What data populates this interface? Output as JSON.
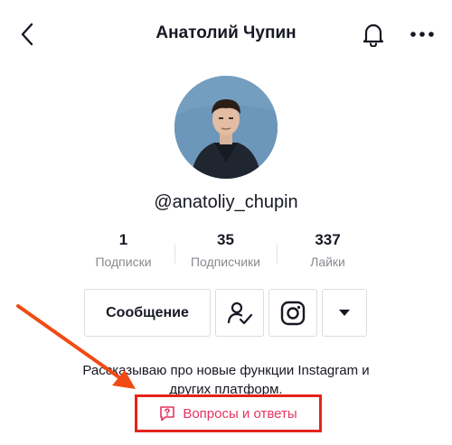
{
  "header": {
    "title": "Анатолий Чупин",
    "back_icon": "chevron-left-icon",
    "notifications_icon": "bell-icon",
    "more_icon": "more-horizontal-icon"
  },
  "profile": {
    "username": "@anatoliy_chupin",
    "stats": [
      {
        "value": "1",
        "label": "Подписки"
      },
      {
        "value": "35",
        "label": "Подписчики"
      },
      {
        "value": "337",
        "label": "Лайки"
      }
    ]
  },
  "actions": {
    "message_label": "Сообщение",
    "friends_icon": "user-check-icon",
    "instagram_icon": "instagram-icon",
    "dropdown_icon": "triangle-down-icon"
  },
  "bio": {
    "line1": "Рассказываю про новые функции Instagram и",
    "line2": "других платформ."
  },
  "qa": {
    "label": "Вопросы и ответы",
    "icon": "question-bubble-icon"
  },
  "colors": {
    "accent_pink": "#e63361",
    "highlight_red": "#e5231b",
    "text_primary": "#161823",
    "text_secondary": "#8a8b91"
  }
}
